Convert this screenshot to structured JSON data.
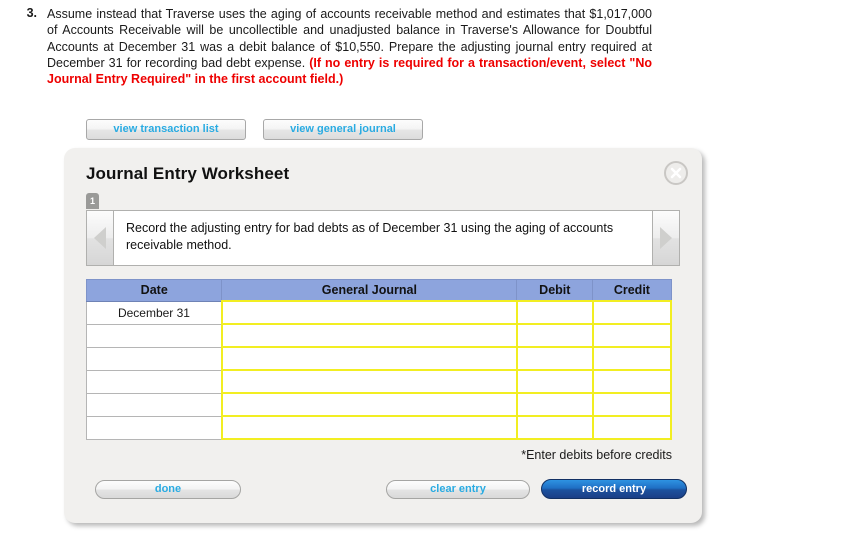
{
  "question": {
    "number": "3.",
    "body_plain": "Assume instead that Traverse uses the aging of accounts receivable method and estimates that $1,017,000 of Accounts Receivable will be uncollectible and unadjusted balance in Traverse's Allowance for Doubtful Accounts at December 31 was a debit balance of $10,550. Prepare the adjusting journal entry required at December 31 for recording bad debt expense.",
    "note_red": "(If no entry is required for a transaction/event, select \"No Journal Entry Required\" in the first account field.)",
    "red_color": "#ee0000"
  },
  "toolbar": {
    "view_transaction_list": "view transaction list",
    "view_general_journal": "view general journal"
  },
  "worksheet": {
    "title": "Journal Entry Worksheet",
    "close_label": "X",
    "tabs": [
      "1"
    ],
    "instruction": "Record the adjusting entry for bad debts as of December 31 using the aging of accounts receivable method.",
    "prev_label": "◀",
    "next_label": "▶",
    "table": {
      "headers": [
        "Date",
        "General Journal",
        "Debit",
        "Credit"
      ],
      "header_color": "#8da4dd",
      "input_border_color": "#f2ee22",
      "rows": [
        {
          "date": "December 31",
          "general_journal": "",
          "debit": "",
          "credit": ""
        },
        {
          "date": "",
          "general_journal": "",
          "debit": "",
          "credit": ""
        },
        {
          "date": "",
          "general_journal": "",
          "debit": "",
          "credit": ""
        },
        {
          "date": "",
          "general_journal": "",
          "debit": "",
          "credit": ""
        },
        {
          "date": "",
          "general_journal": "",
          "debit": "",
          "credit": ""
        },
        {
          "date": "",
          "general_journal": "",
          "debit": "",
          "credit": ""
        }
      ]
    },
    "footnote": "*Enter debits before credits",
    "buttons": {
      "done": "done",
      "clear_entry": "clear entry",
      "record_entry": "record entry"
    }
  }
}
